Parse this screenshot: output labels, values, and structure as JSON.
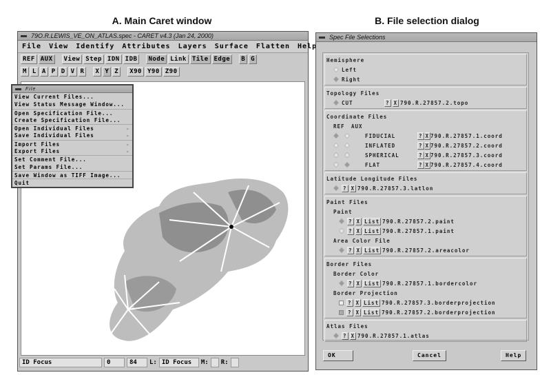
{
  "captions": {
    "a": "A. Main Caret window",
    "b": "B. File selection dialog"
  },
  "main": {
    "title": "79O.R.LEWIS_VE_ON_ATLAS.spec - CARET v4.3 (Jan 24, 2000)",
    "menu": [
      "File",
      "View",
      "Identify",
      "Attributes",
      "Layers",
      "Surface",
      "Flatten",
      "Help"
    ],
    "toolbar1": [
      "REF",
      "AUX",
      "View",
      "Step",
      "IDN",
      "IDB",
      "Node",
      "Link",
      "Tile",
      "Edge",
      "B",
      "G"
    ],
    "toolbar2": [
      "M",
      "L",
      "A",
      "P",
      "D",
      "V",
      "R",
      "X",
      "Y",
      "Z",
      "X90",
      "Y90",
      "Z90"
    ],
    "status": {
      "mode": "ID Focus",
      "v1": "0",
      "v2": "84",
      "l_label": "L:",
      "l_value": "ID Focus",
      "m_label": "M:",
      "m_value": "",
      "r_label": "R:",
      "r_value": ""
    }
  },
  "file_menu": {
    "title": "File",
    "items": [
      "View Current Files...",
      "View Status Message Window...",
      "Open Specification File...",
      "Create Specification File...",
      "Open Individual Files",
      "Save Individual Files",
      "Import Files",
      "Export Files",
      "Set Comment File...",
      "Set Params File...",
      "Save Window as TIFF Image...",
      "Quit"
    ]
  },
  "dialog": {
    "title": "Spec File Selections",
    "hemisphere": {
      "title": "Hemisphere",
      "left": "Left",
      "right": "Right",
      "selected": "Right"
    },
    "topology": {
      "title": "Topology Files",
      "type": "CUT",
      "file": "790.R.27857.2.topo"
    },
    "coord": {
      "title": "Coordinate Files",
      "ref": "REF",
      "aux": "AUX",
      "rows": [
        {
          "type": "FIDUCIAL",
          "file": "790.R.27857.1.coord"
        },
        {
          "type": "INFLATED",
          "file": "790.R.27857.2.coord"
        },
        {
          "type": "SPHERICAL",
          "file": "790.R.27857.3.coord"
        },
        {
          "type": "FLAT",
          "file": "790.R.27857.4.coord"
        }
      ]
    },
    "latlon": {
      "title": "Latitude Longitude Files",
      "file": "790.R.27857.3.latlon"
    },
    "paint": {
      "title": "Paint Files",
      "sub": "Paint",
      "files": [
        "790.R.27857.2.paint",
        "790.R.27857.1.paint"
      ],
      "area_title": "Area Color File",
      "area_file": "790.R.27857.2.areacolor"
    },
    "border": {
      "title": "Border Files",
      "color_title": "Border Color",
      "color_file": "790.R.27857.1.bordercolor",
      "proj_title": "Border Projection",
      "proj_files": [
        "790.R.27857.3.borderprojection",
        "790.R.27857.2.borderprojection"
      ]
    },
    "atlas": {
      "title": "Atlas Files",
      "file": "790.R.27857.1.atlas"
    },
    "btn": {
      "q": "?",
      "x": "X",
      "list": "List"
    },
    "ok": "OK",
    "cancel": "Cancel",
    "help": "Help"
  }
}
